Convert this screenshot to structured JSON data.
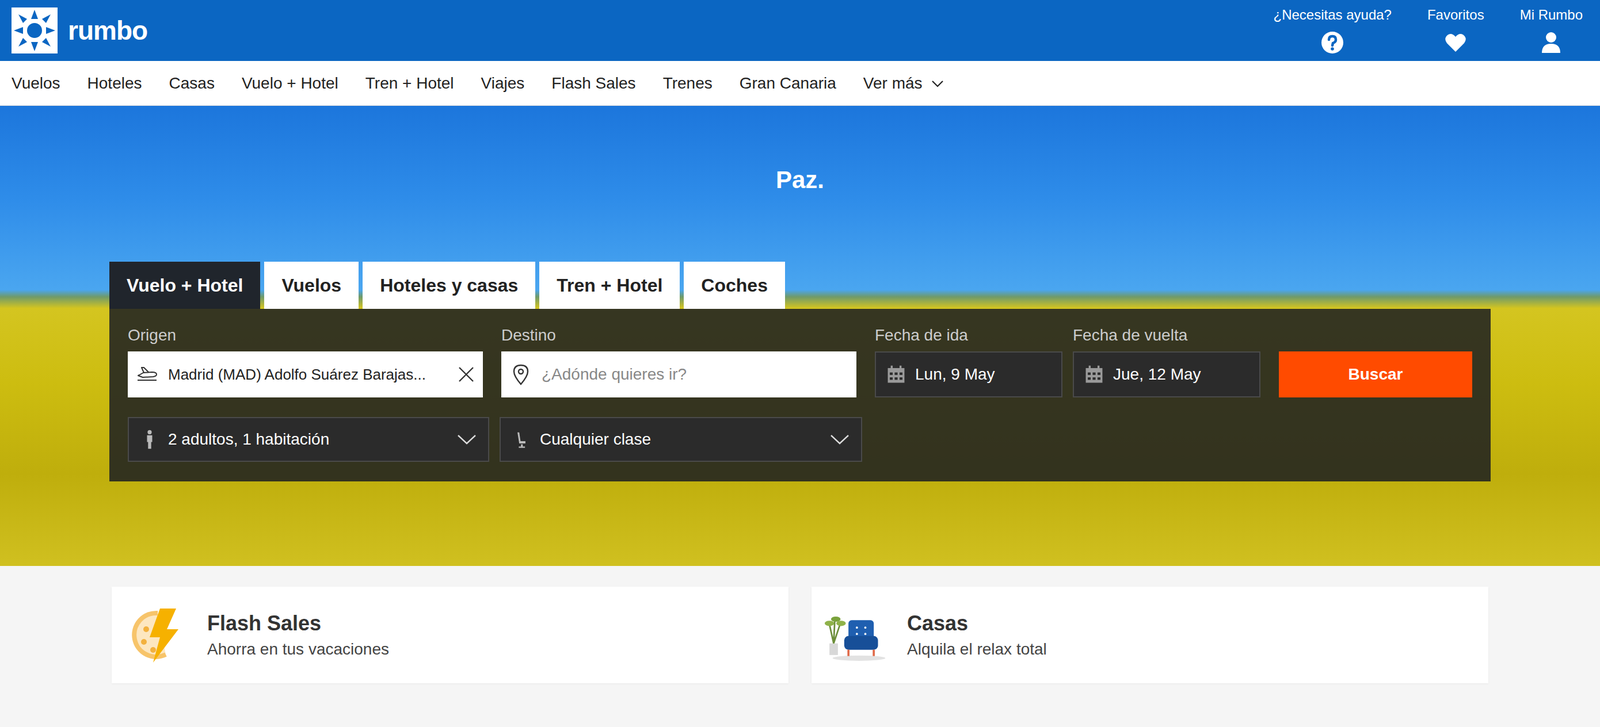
{
  "logo": {
    "text": "rumbo"
  },
  "header_links": [
    {
      "label": "¿Necesitas ayuda?",
      "icon": "help"
    },
    {
      "label": "Favoritos",
      "icon": "heart"
    },
    {
      "label": "Mi Rumbo",
      "icon": "user"
    }
  ],
  "nav": [
    {
      "label": "Vuelos"
    },
    {
      "label": "Hoteles"
    },
    {
      "label": "Casas"
    },
    {
      "label": "Vuelo + Hotel"
    },
    {
      "label": "Tren + Hotel"
    },
    {
      "label": "Viajes"
    },
    {
      "label": "Flash Sales"
    },
    {
      "label": "Trenes"
    },
    {
      "label": "Gran Canaria"
    },
    {
      "label": "Ver más",
      "dropdown": true
    }
  ],
  "hero": {
    "title": "Paz."
  },
  "search": {
    "tabs": [
      {
        "label": "Vuelo + Hotel",
        "selected": true
      },
      {
        "label": "Vuelos",
        "selected": false
      },
      {
        "label": "Hoteles y casas",
        "selected": false
      },
      {
        "label": "Tren + Hotel",
        "selected": false
      },
      {
        "label": "Coches",
        "selected": false
      }
    ],
    "origin": {
      "label": "Origen",
      "value": "Madrid (MAD) Adolfo Suárez Barajas..."
    },
    "destination": {
      "label": "Destino",
      "placeholder": "¿Adónde quieres ir?"
    },
    "departure": {
      "label": "Fecha de ida",
      "value": "Lun, 9 May"
    },
    "return": {
      "label": "Fecha de vuelta",
      "value": "Jue, 12 May"
    },
    "button": "Buscar",
    "travellers": "2 adultos, 1 habitación",
    "cabin": "Cualquier clase"
  },
  "promos": [
    {
      "title": "Flash Sales",
      "subtitle": "Ahorra en tus vacaciones",
      "icon": "flash"
    },
    {
      "title": "Casas",
      "subtitle": "Alquila el relax total",
      "icon": "armchair"
    }
  ]
}
